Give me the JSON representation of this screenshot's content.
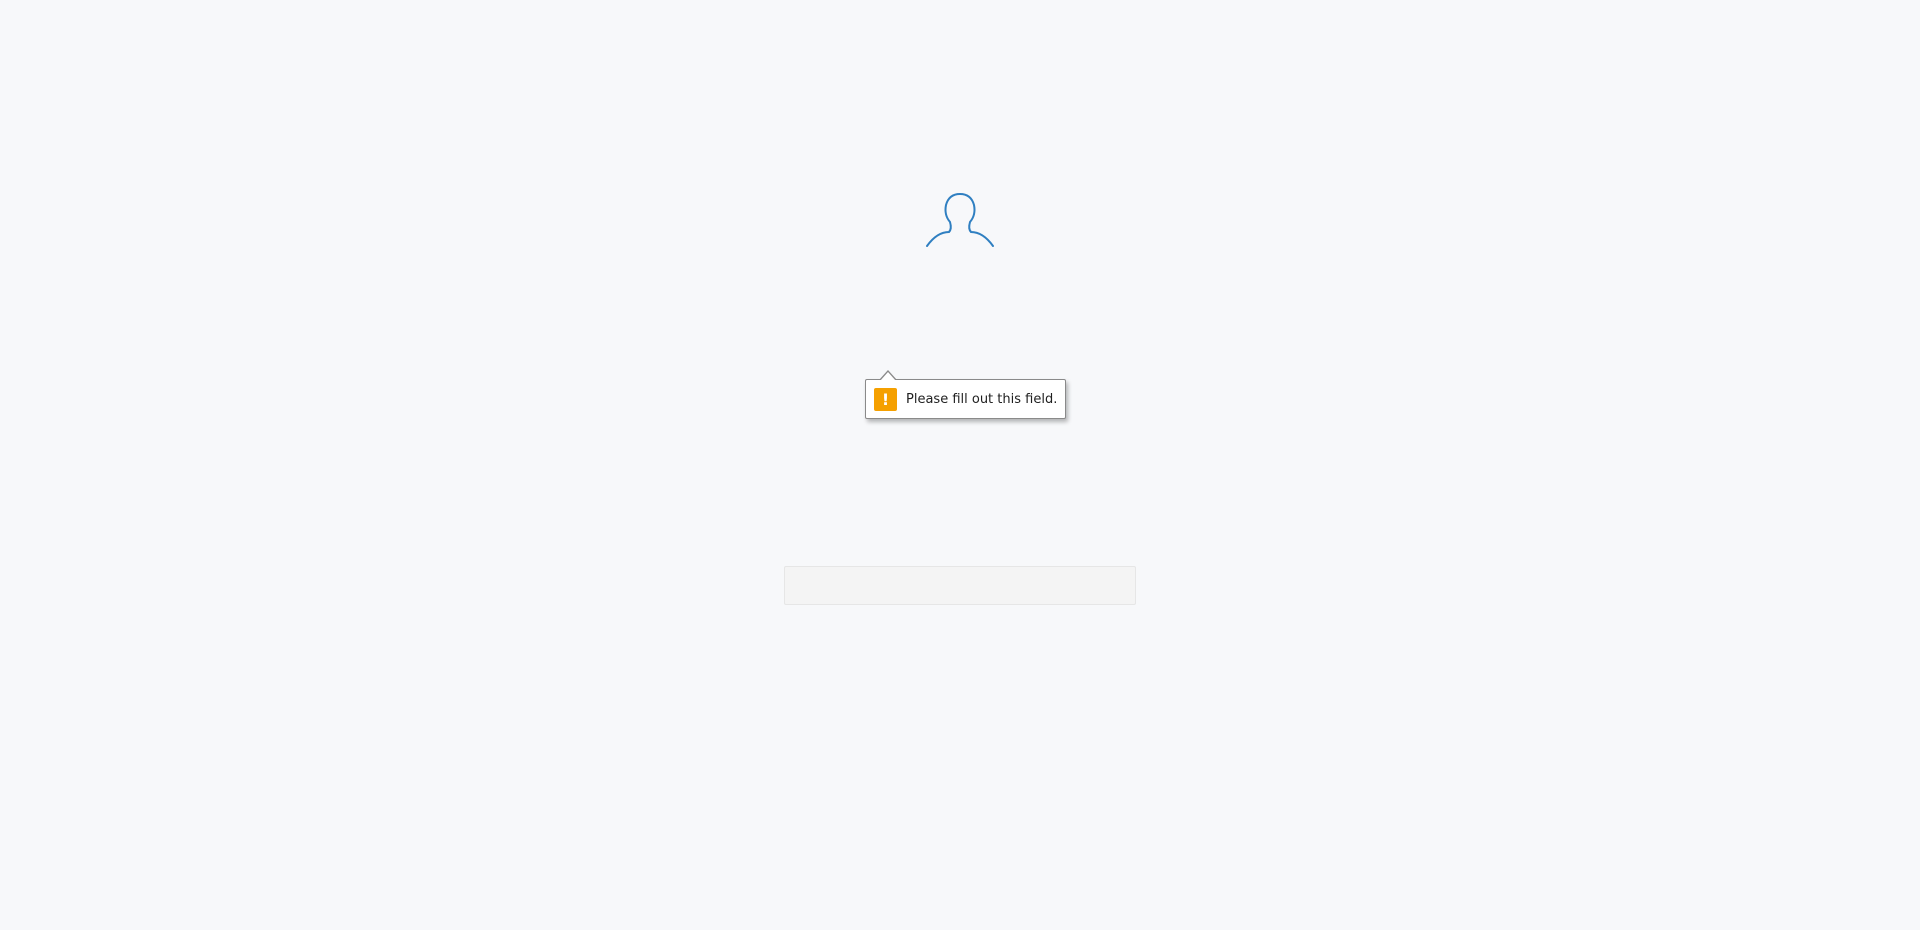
{
  "validation": {
    "message": "Please fill out this field.",
    "icon": "warning-icon",
    "icon_symbol": "!",
    "icon_color": "#f5a000"
  },
  "user_avatar": {
    "icon": "user-silhouette-icon",
    "color": "#2f7fc1"
  },
  "input": {
    "value": "",
    "placeholder": ""
  },
  "background": {
    "color": "#f7f8fa",
    "pattern_color": "#e3e6ea"
  }
}
